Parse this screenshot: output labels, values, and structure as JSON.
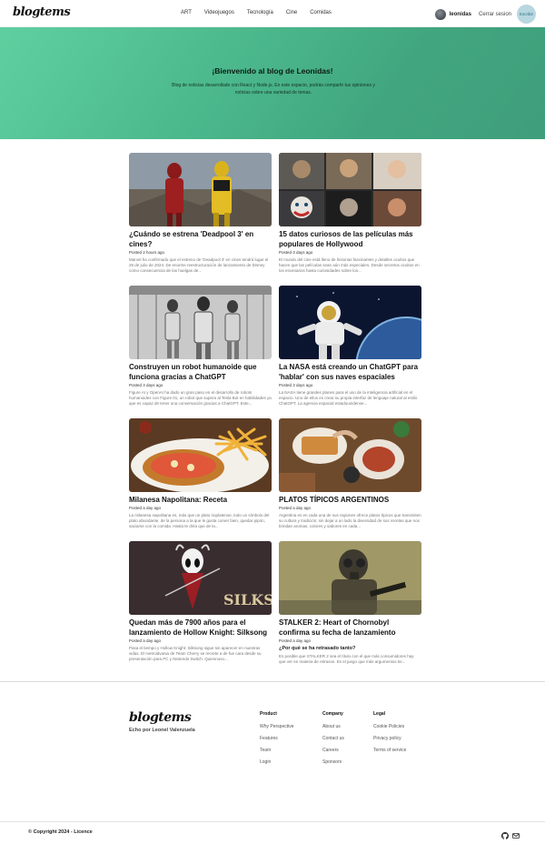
{
  "header": {
    "logo": "blogtems",
    "nav": [
      "ART",
      "Videojuegos",
      "Tecnología",
      "Cine",
      "Comidas"
    ],
    "username": "leonidas",
    "logout_label": "Cerrar sesion",
    "badge_label": "Escribir"
  },
  "hero": {
    "title": "¡Bienvenido al blog de Leonidas!",
    "description": "Blog de noticias desarrollado con React y Node.js. En este espacio, podrás compartir tus opiniones y noticias sobre una variedad de temas."
  },
  "posts": [
    {
      "title": "¿Cuándo se estrena 'Deadpool 3' en cines?",
      "date": "Posted 2 hours ago",
      "excerpt": "Marvel ha confirmado que el estreno de 'Deadpool 3' en cines tendrá lugar el 26 de julio de 2024. De enorme reestructuración de lanzamiento de Disney como consecuencia de las huelgas de..."
    },
    {
      "title": "15 datos curiosos de las películas más populares de Hollywood",
      "date": "Posted 3 days ago",
      "excerpt": "El mundo del cine está lleno de historias fascinantes y detalles ocultos que hacen que las películas sean aún más especiales. Desde secretos ocultos en los escenarios hasta curiosidades sobre los..."
    },
    {
      "title": "Construyen un robot humanoide que funciona gracias a ChatGPT",
      "date": "Posted 3 days ago",
      "excerpt": "Figure AI y OpenAI ha dado un gran paso en el desarrollo de robots humanoides con Figure 01, un robot que supera al Tesla Bot en habilidades ya que es capaz de tener una conversación gracias a ChatGPT. Este..."
    },
    {
      "title": "La NASA está creando un ChatGPT para 'hablar' con sus naves espaciales",
      "date": "Posted 3 days ago",
      "excerpt": "La NASA tiene grandes planes para el uso de la inteligencia artificial en el espacio. Uno de ellos es crear su propia interfaz de lenguaje natural al estilo ChatGPT. La agencia espacial estadounidense..."
    },
    {
      "title": "Milanesa Napolitana: Receta",
      "date": "Posted a day ago",
      "excerpt": "La milanesa napolitana es, más que un plato rioplatense, todo un símbolo del plato abundante, de la persona a la que le gusta comer bien, quedar pipón, saciarse con la comida. Hasta te diría que de la..."
    },
    {
      "title": "PLATOS TÍPICOS ARGENTINOS",
      "date": "Posted a day ago",
      "excerpt": "Argentina es en cada una de sus regiones ofrece platos típicos que transmiten su cultura y tradición; sin dejar a un lado la diversidad de sus recetas que nos brindan aromas, colores y sabores en cada..."
    },
    {
      "title": "Quedan más de 7900 años para el lanzamiento de Hollow Knight: Silksong",
      "date": "Posted a day ago",
      "excerpt": "Pasa el tiempo y Hollow Knight: Silksong sigue sin aparecer en nuestras vidas. El metroidvania de Team Cherry se recrete a de fue cara desde su presentación para PC y Nintendo Switch. Quiennoso..."
    },
    {
      "title": "STALKER 2: Heart of Chornobyl confirma su fecha de lanzamiento",
      "date": "Posted a day ago",
      "subheading": "¿Por qué se ha retrasado tanto?",
      "excerpt": "Es posible que STALKER 2 sea el título con el que más consumidores hay que ver en materia de retrasos. Es el juego que más argumentos tie..."
    }
  ],
  "footer": {
    "logo": "blogtems",
    "tagline": "Echo por Leonel Valenzuela",
    "columns": [
      {
        "heading": "Product",
        "items": [
          "Why Perspective",
          "Features",
          "Team",
          "Login"
        ]
      },
      {
        "heading": "Company",
        "items": [
          "About us",
          "Contact us",
          "Careers",
          "Sponsors"
        ]
      },
      {
        "heading": "Legal",
        "items": [
          "Cookie Policies",
          "Privacy policy",
          "Terms of service"
        ]
      }
    ],
    "copyright": "© Copyright 2024 - Licence",
    "social_icons": [
      "github-icon",
      "mail-icon"
    ]
  }
}
